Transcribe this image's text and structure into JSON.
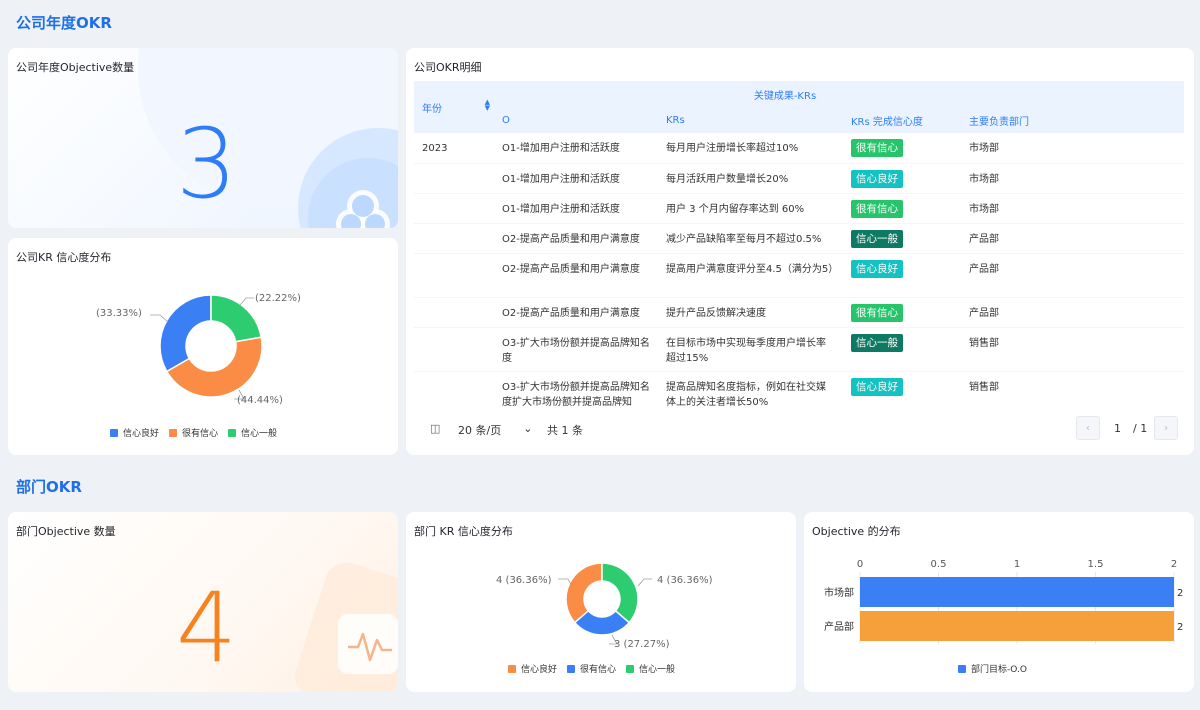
{
  "sections": {
    "company_title": "公司年度OKR",
    "dept_title": "部门OKR"
  },
  "company_objective_card": {
    "title": "公司年度Objective数量",
    "value": "3",
    "color": "#2f7df6"
  },
  "company_kr_donut": {
    "title": "公司KR 信心度分布",
    "labels": {
      "a": "(33.33%)",
      "b": "(22.22%)",
      "c": "(44.44%)"
    },
    "legend": [
      "信心良好",
      "很有信心",
      "信心一般"
    ]
  },
  "okr_table": {
    "title": "公司OKR明细",
    "headers": {
      "year": "年份",
      "group": "关键成果-KRs",
      "objective": "O",
      "krs": "KRs",
      "confidence": "KRs 完成信心度",
      "department": "主要负责部门"
    },
    "rows": [
      {
        "year": "2023",
        "objective": "O1-增加用户注册和活跃度",
        "kr": "每月用户注册增长率超过10%",
        "confidence": "很有信心",
        "department": "市场部"
      },
      {
        "year": "",
        "objective": "O1-增加用户注册和活跃度",
        "kr": "每月活跃用户数量增长20%",
        "confidence": "信心良好",
        "department": "市场部"
      },
      {
        "year": "",
        "objective": "O1-增加用户注册和活跃度",
        "kr": "用户 3 个月内留存率达到 60%",
        "confidence": "很有信心",
        "department": "市场部"
      },
      {
        "year": "",
        "objective": "O2-提高产品质量和用户满意度",
        "kr": "减少产品缺陷率至每月不超过0.5%",
        "confidence": "信心一般",
        "department": "产品部"
      },
      {
        "year": "",
        "objective": "O2-提高产品质量和用户满意度",
        "kr": "提高用户满意度评分至4.5（满分为5）",
        "confidence": "信心良好",
        "department": "产品部"
      },
      {
        "year": "",
        "objective": "O2-提高产品质量和用户满意度",
        "kr": "提升产品反馈解决速度",
        "confidence": "很有信心",
        "department": "产品部"
      },
      {
        "year": "",
        "objective": "O3-扩大市场份额并提高品牌知名度",
        "kr": "在目标市场中实现每季度用户增长率超过15%",
        "confidence": "信心一般",
        "department": "销售部"
      },
      {
        "year": "",
        "objective": "O3-扩大市场份额并提高品牌知名度扩大市场份额并提高品牌知",
        "kr": "提高品牌知名度指标，例如在社交媒体上的关注者增长50%",
        "confidence": "信心良好",
        "department": "销售部"
      }
    ],
    "tag_colors": {
      "很有信心": "#27c46b",
      "信心良好": "#13c2c2",
      "信心一般": "#0f7a63"
    },
    "pager": {
      "page_size": "20 条/页",
      "total": "共 1 条",
      "page": "1",
      "total_pages": "/ 1"
    }
  },
  "dept_objective_card": {
    "title": "部门Objective 数量",
    "value": "4",
    "color": "#f6831f"
  },
  "dept_kr_donut": {
    "title": "部门 KR 信心度分布",
    "labels": {
      "a": "4 (36.36%)",
      "b": "4 (36.36%)",
      "c": "3 (27.27%)"
    },
    "legend": [
      "信心良好",
      "很有信心",
      "信心一般"
    ]
  },
  "objective_distribution": {
    "title": "Objective 的分布",
    "legend": "部门目标-O.O"
  },
  "chart_data": [
    {
      "type": "pie",
      "labels": [
        "信心良好",
        "很有信心",
        "信心一般"
      ],
      "values": [
        33.33,
        44.44,
        22.22
      ],
      "colors": [
        "#3b7ff5",
        "#fa8c45",
        "#2ecc71"
      ]
    },
    {
      "type": "pie",
      "labels": [
        "信心良好",
        "很有信心",
        "信心一般"
      ],
      "values": [
        36.36,
        27.27,
        36.36
      ],
      "colors": [
        "#fa8c45",
        "#3b7ff5",
        "#2ecc71"
      ]
    },
    {
      "type": "bar",
      "categories": [
        "市场部",
        "产品部"
      ],
      "values": [
        2,
        2
      ],
      "xlim": [
        0,
        2
      ],
      "ticks": [
        "0",
        "0.5",
        "1",
        "1.5",
        "2"
      ],
      "value_labels": [
        "2",
        "2"
      ],
      "colors": [
        "#3b7ff5",
        "#f5a03a"
      ]
    }
  ]
}
